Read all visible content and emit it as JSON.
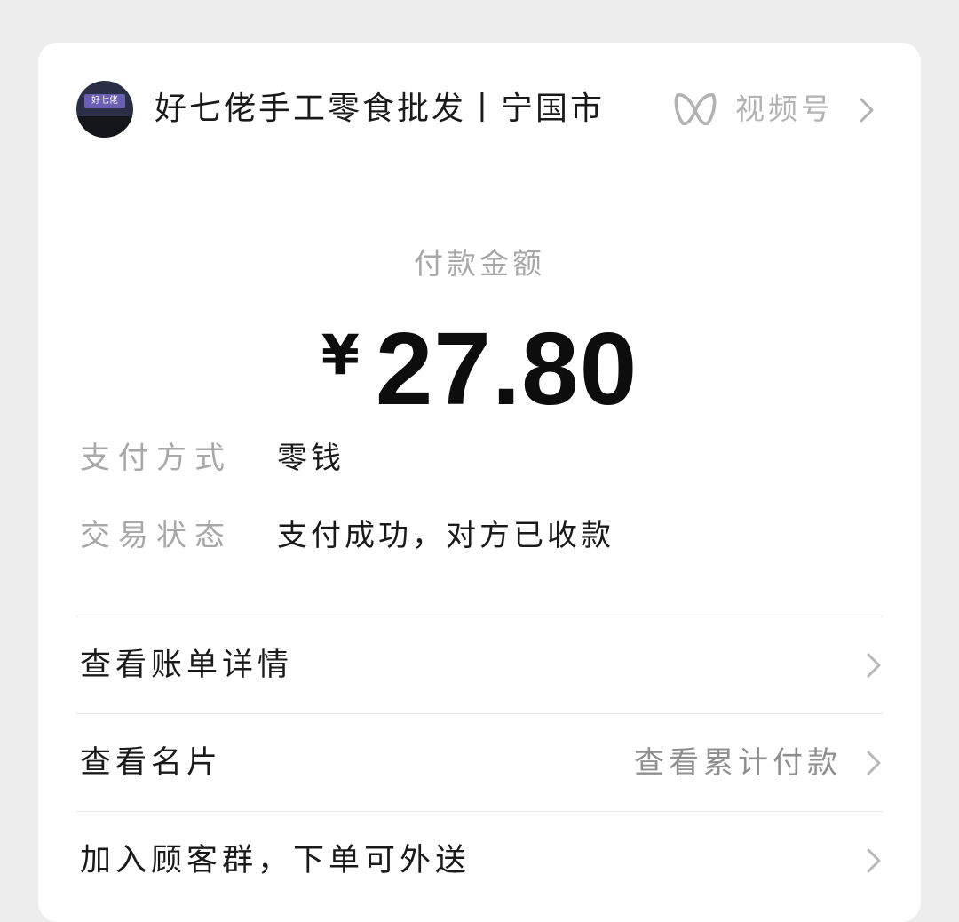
{
  "merchant": {
    "name": "好七佬手工零食批发丨宁国市",
    "avatar_sign": "好七佬"
  },
  "channels": {
    "label": "视频号",
    "icon": "channels-icon"
  },
  "payment": {
    "amount_label": "付款金额",
    "currency_symbol": "¥",
    "amount": "27.80"
  },
  "details": [
    {
      "label": "支付方式",
      "value": "零钱"
    },
    {
      "label": "交易状态",
      "value": "支付成功，对方已收款"
    }
  ],
  "menu": [
    {
      "label": "查看账单详情",
      "extra": ""
    },
    {
      "label": "查看名片",
      "extra": "查看累计付款"
    },
    {
      "label": "加入顾客群，下单可外送",
      "extra": ""
    }
  ],
  "colors": {
    "background": "#ededed",
    "card": "#ffffff",
    "primary_text": "#1a1a1a",
    "secondary_text": "#a8a8a8"
  }
}
